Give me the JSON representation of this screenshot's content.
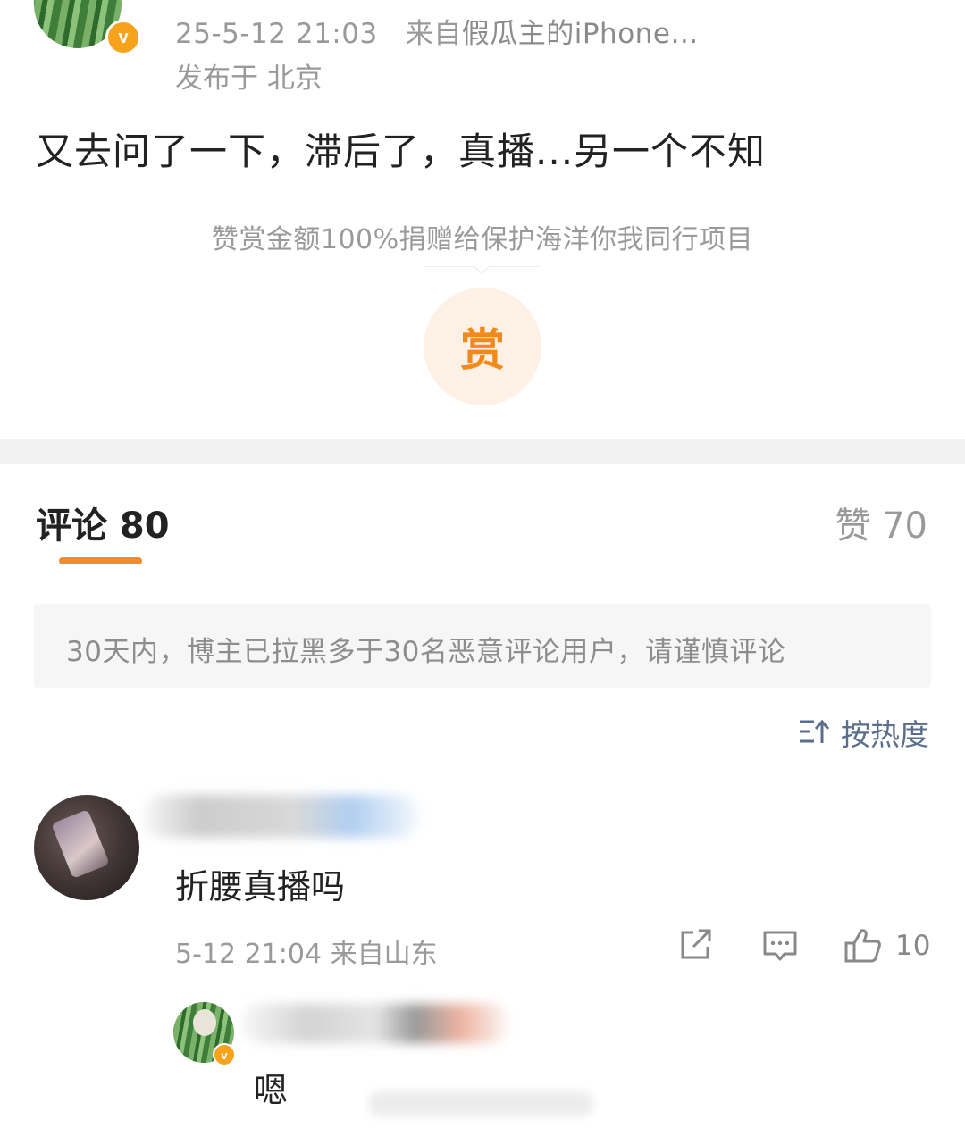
{
  "post": {
    "timestamp": "25-5-12 21:03",
    "source_prefix": "来自",
    "source_name": "假瓜主的iPhone…",
    "location": "发布于 北京",
    "text": "又去问了一下，滞后了，真播...另一个不知",
    "verified_badge": "v"
  },
  "reward": {
    "note": "赞赏金额100%捐赠给保护海洋你我同行项目",
    "button_label": "赏",
    "accent_color": "#f08a1c"
  },
  "tabs": {
    "comments_label": "评论 80",
    "likes_label": "赞 70",
    "active_color": "#f38a2d"
  },
  "notice": {
    "text": "30天内，博主已拉黑多于30名恶意评论用户，请谨慎评论"
  },
  "sort": {
    "label": "按热度",
    "icon": "sort-icon"
  },
  "comment": {
    "text": "折腰真播吗",
    "meta": "5-12 21:04  来自山东",
    "like_count": "10",
    "icons": [
      "share-icon",
      "reply-icon",
      "thumbs-up-icon"
    ]
  },
  "reply": {
    "text": "嗯",
    "verified_badge": "v"
  }
}
